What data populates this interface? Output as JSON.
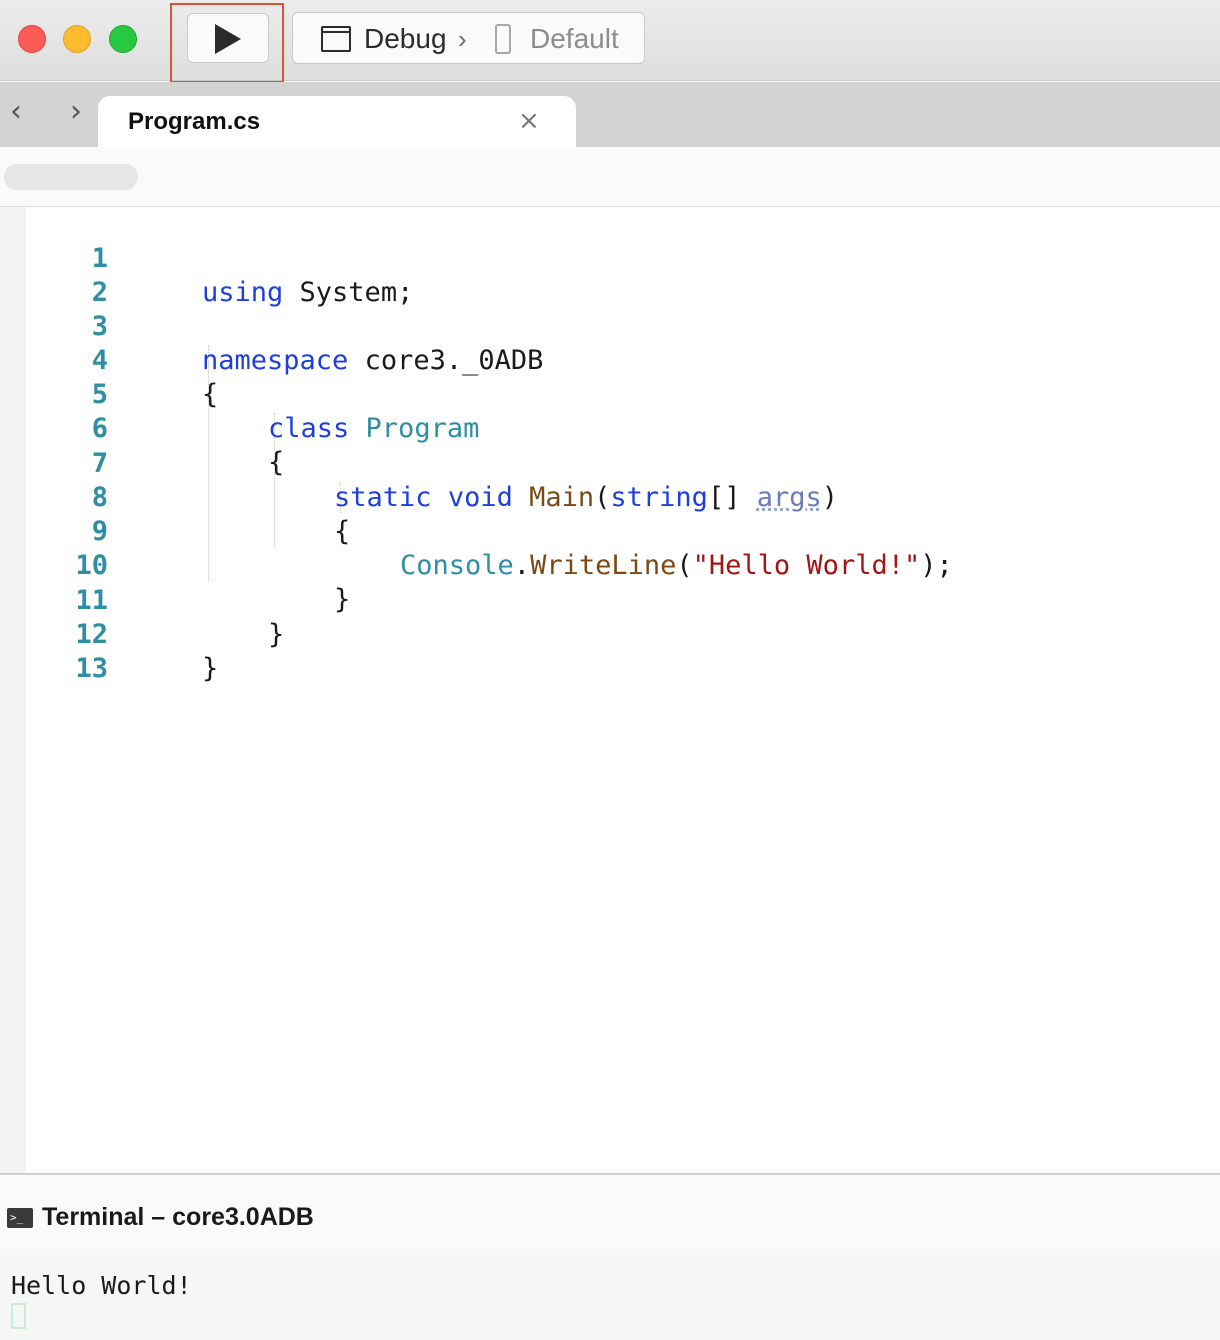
{
  "toolbar": {
    "configuration": "Debug",
    "separator": "›",
    "target": "Default"
  },
  "tabbar": {
    "back_glyph": "‹",
    "forward_glyph": "›",
    "active_tab": "Program.cs",
    "close_glyph": "×"
  },
  "editor": {
    "line_numbers": [
      "1",
      "2",
      "3",
      "4",
      "5",
      "6",
      "7",
      "8",
      "9",
      "10",
      "11",
      "12",
      "13"
    ],
    "tokens": {
      "l1_kw": "using",
      "l1_rest": " System;",
      "l3_kw": "namespace",
      "l3_rest": " core3._0ADB",
      "l4": "{",
      "l5_kw": "class",
      "l5_type": "Program",
      "l6": "{",
      "l7_kw1": "static",
      "l7_kw2": "void",
      "l7_meth": "Main",
      "l7_open": "(",
      "l7_kw3": "string",
      "l7_arr": "[] ",
      "l7_param": "args",
      "l7_close": ")",
      "l8": "{",
      "l9_type": "Console",
      "l9_dot": ".",
      "l9_meth": "WriteLine",
      "l9_open": "(",
      "l9_str": "\"Hello World!\"",
      "l9_close": ");",
      "l10": "}",
      "l11": "}",
      "l12": "}"
    }
  },
  "terminal": {
    "title": "Terminal – core3.0ADB",
    "icon_glyph": ">_",
    "output": "Hello World!"
  }
}
